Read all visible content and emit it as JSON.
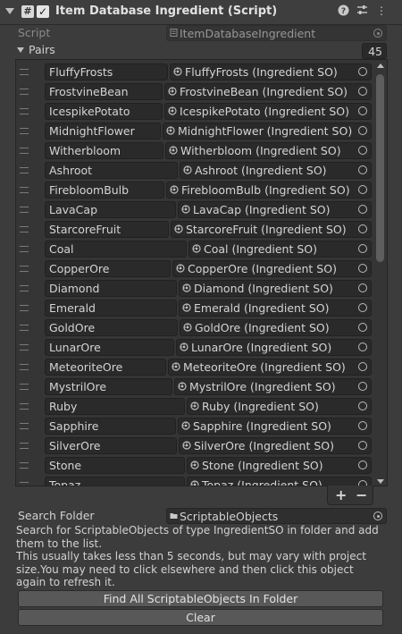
{
  "header": {
    "title": "Item Database Ingredient (Script)"
  },
  "script_field": {
    "label": "Script",
    "value": "ItemDatabaseIngredient"
  },
  "pairs": {
    "label": "Pairs",
    "count": "45",
    "items": [
      {
        "key": "FluffyFrosts",
        "value": "FluffyFrosts (Ingredient SO)"
      },
      {
        "key": "FrostvineBean",
        "value": "FrostvineBean (Ingredient SO)"
      },
      {
        "key": "IcespikePotato",
        "value": "IcespikePotato (Ingredient SO)"
      },
      {
        "key": "MidnightFlower",
        "value": "MidnightFlower (Ingredient SO)"
      },
      {
        "key": "Witherbloom",
        "value": "Witherbloom (Ingredient SO)"
      },
      {
        "key": "Ashroot",
        "value": "Ashroot (Ingredient SO)"
      },
      {
        "key": "FirebloomBulb",
        "value": "FirebloomBulb (Ingredient SO)"
      },
      {
        "key": "LavaCap",
        "value": "LavaCap (Ingredient SO)"
      },
      {
        "key": "StarcoreFruit",
        "value": "StarcoreFruit (Ingredient SO)"
      },
      {
        "key": "Coal",
        "value": "Coal (Ingredient SO)"
      },
      {
        "key": "CopperOre",
        "value": "CopperOre (Ingredient SO)"
      },
      {
        "key": "Diamond",
        "value": "Diamond (Ingredient SO)"
      },
      {
        "key": "Emerald",
        "value": "Emerald (Ingredient SO)"
      },
      {
        "key": "GoldOre",
        "value": "GoldOre (Ingredient SO)"
      },
      {
        "key": "LunarOre",
        "value": "LunarOre (Ingredient SO)"
      },
      {
        "key": "MeteoriteOre",
        "value": "MeteoriteOre (Ingredient SO)"
      },
      {
        "key": "MystrilOre",
        "value": "MystrilOre (Ingredient SO)"
      },
      {
        "key": "Ruby",
        "value": "Ruby (Ingredient SO)"
      },
      {
        "key": "Sapphire",
        "value": "Sapphire (Ingredient SO)"
      },
      {
        "key": "SilverOre",
        "value": "SilverOre (Ingredient SO)"
      },
      {
        "key": "Stone",
        "value": "Stone (Ingredient SO)"
      },
      {
        "key": "Topaz",
        "value": "Topaz (Ingredient SO)"
      }
    ]
  },
  "search_folder": {
    "label": "Search Folder",
    "value": "ScriptableObjects"
  },
  "help": {
    "line1": "Search for ScriptableObjects of type IngredientSO in folder and add them to the list.",
    "line2": "This usually takes less than 5 seconds, but may vary with project size.You may need to click elsewhere and then click this object again to refresh it."
  },
  "buttons": {
    "find_all": "Find All ScriptableObjects In Folder",
    "clear": "Clear"
  }
}
